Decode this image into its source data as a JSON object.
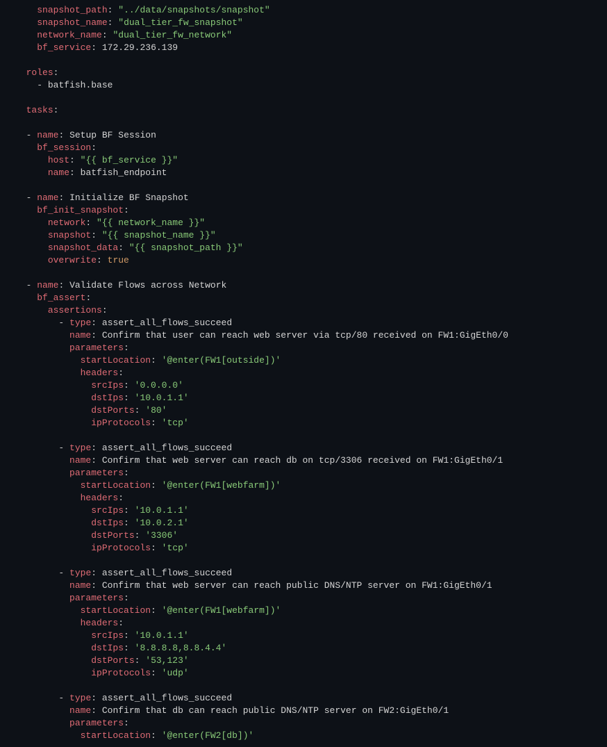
{
  "vars": {
    "snapshot_path_key": "snapshot_path",
    "snapshot_path_val": "\"../data/snapshots/snapshot\"",
    "snapshot_name_key": "snapshot_name",
    "snapshot_name_val": "\"dual_tier_fw_snapshot\"",
    "network_name_key": "network_name",
    "network_name_val": "\"dual_tier_fw_network\"",
    "bf_service_key": "bf_service",
    "bf_service_val": "172.29.236.139"
  },
  "roles": {
    "key": "roles",
    "item0": "batfish.base"
  },
  "tasks_key": "tasks",
  "task1": {
    "name_key": "name",
    "name_val": "Setup BF Session",
    "bf_session_key": "bf_session",
    "host_key": "host",
    "host_val": "\"{{ bf_service }}\"",
    "endpoint_name_key": "name",
    "endpoint_name_val": "batfish_endpoint"
  },
  "task2": {
    "name_key": "name",
    "name_val": "Initialize BF Snapshot",
    "bf_init_key": "bf_init_snapshot",
    "network_key": "network",
    "network_val": "\"{{ network_name }}\"",
    "snapshot_key": "snapshot",
    "snapshot_val": "\"{{ snapshot_name }}\"",
    "snapshot_data_key": "snapshot_data",
    "snapshot_data_val": "\"{{ snapshot_path }}\"",
    "overwrite_key": "overwrite",
    "overwrite_val": "true"
  },
  "task3": {
    "name_key": "name",
    "name_val": "Validate Flows across Network",
    "bf_assert_key": "bf_assert",
    "assertions_key": "assertions"
  },
  "a1": {
    "type_key": "type",
    "type_val": "assert_all_flows_succeed",
    "name_key": "name",
    "name_val": "Confirm that user can reach web server via tcp/80 received on FW1:GigEth0/0",
    "parameters_key": "parameters",
    "startLocation_key": "startLocation",
    "startLocation_val": "'@enter(FW1[outside])'",
    "headers_key": "headers",
    "srcIps_key": "srcIps",
    "srcIps_val": "'0.0.0.0'",
    "dstIps_key": "dstIps",
    "dstIps_val": "'10.0.1.1'",
    "dstPorts_key": "dstPorts",
    "dstPorts_val": "'80'",
    "ipProtocols_key": "ipProtocols",
    "ipProtocols_val": "'tcp'"
  },
  "a2": {
    "type_key": "type",
    "type_val": "assert_all_flows_succeed",
    "name_key": "name",
    "name_val": "Confirm that web server can reach db on tcp/3306 received on FW1:GigEth0/1",
    "parameters_key": "parameters",
    "startLocation_key": "startLocation",
    "startLocation_val": "'@enter(FW1[webfarm])'",
    "headers_key": "headers",
    "srcIps_key": "srcIps",
    "srcIps_val": "'10.0.1.1'",
    "dstIps_key": "dstIps",
    "dstIps_val": "'10.0.2.1'",
    "dstPorts_key": "dstPorts",
    "dstPorts_val": "'3306'",
    "ipProtocols_key": "ipProtocols",
    "ipProtocols_val": "'tcp'"
  },
  "a3": {
    "type_key": "type",
    "type_val": "assert_all_flows_succeed",
    "name_key": "name",
    "name_val": "Confirm that web server can reach public DNS/NTP server on FW1:GigEth0/1",
    "parameters_key": "parameters",
    "startLocation_key": "startLocation",
    "startLocation_val": "'@enter(FW1[webfarm])'",
    "headers_key": "headers",
    "srcIps_key": "srcIps",
    "srcIps_val": "'10.0.1.1'",
    "dstIps_key": "dstIps",
    "dstIps_val": "'8.8.8.8,8.8.4.4'",
    "dstPorts_key": "dstPorts",
    "dstPorts_val": "'53,123'",
    "ipProtocols_key": "ipProtocols",
    "ipProtocols_val": "'udp'"
  },
  "a4": {
    "type_key": "type",
    "type_val": "assert_all_flows_succeed",
    "name_key": "name",
    "name_val": "Confirm that db can reach public DNS/NTP server on FW2:GigEth0/1",
    "parameters_key": "parameters",
    "startLocation_key": "startLocation",
    "startLocation_val": "'@enter(FW2[db])'"
  }
}
